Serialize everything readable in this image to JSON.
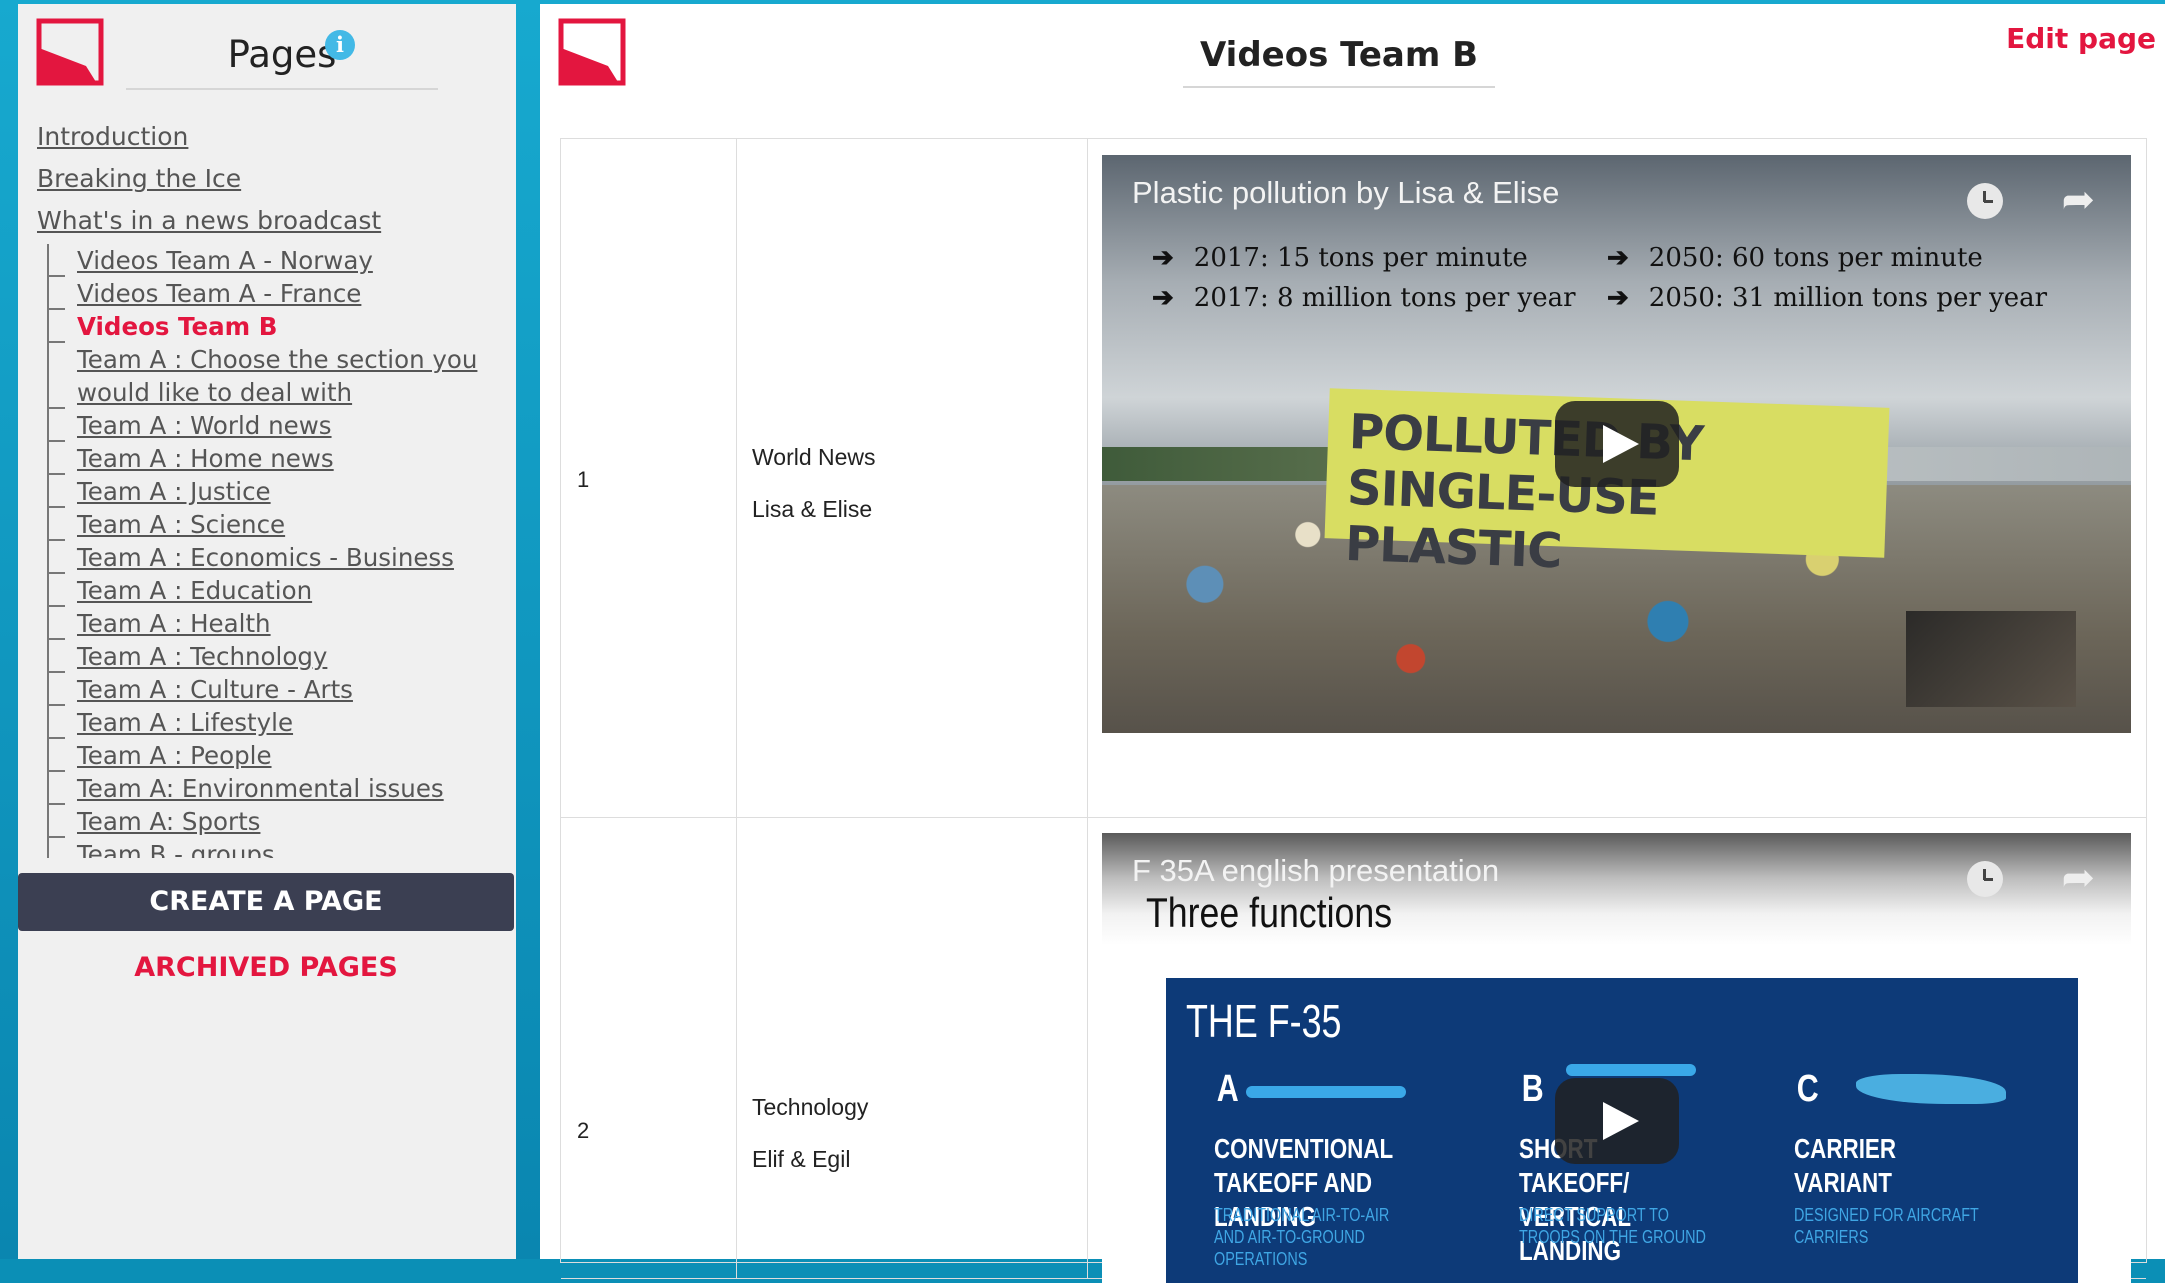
{
  "sidebar": {
    "title": "Pages",
    "top_links": [
      "Introduction",
      "Breaking the Ice",
      "What's in a news broadcast"
    ],
    "sub_links": [
      "Videos Team A - Norway",
      "Videos Team A - France",
      "Videos Team B",
      "Team A : Choose the section you would like to deal with",
      "Team A : World news",
      "Team A : Home news",
      "Team A : Justice",
      "Team A : Science",
      "Team A : Economics - Business",
      "Team A : Education",
      "Team A : Health",
      "Team A : Technology",
      "Team A : Culture - Arts",
      "Team A : Lifestyle",
      "Team A : People",
      "Team A: Environmental issues",
      "Team A: Sports",
      "Team B - groups"
    ],
    "active_item": "Videos Team B",
    "create_button": "CREATE A PAGE",
    "archived_link": "ARCHIVED PAGES"
  },
  "main": {
    "title": "Videos Team B",
    "edit_link": "Edit page",
    "rows": [
      {
        "number": "1",
        "category": "World News",
        "authors": "Lisa & Elise",
        "video": {
          "title": "Plastic pollution by Lisa & Elise",
          "stats": [
            "2017: 15 tons per minute",
            "2050: 60 tons per minute",
            "2017: 8 million tons per year",
            "2050: 31 million tons per year"
          ],
          "banner_text": "POLLUTED BY SINGLE-USE PLASTIC"
        }
      },
      {
        "number": "2",
        "category": "Technology",
        "authors": "Elif & Egil",
        "video": {
          "title": "F 35A english presentation",
          "slide_heading": "Three functions",
          "panel_title": "THE F-35",
          "variants": [
            {
              "letter": "A",
              "name": "CONVENTIONAL TAKEOFF AND LANDING",
              "desc": "TRADITIONAL AIR-TO-AIR AND AIR-TO-GROUND OPERATIONS"
            },
            {
              "letter": "B",
              "name": "SHORT TAKEOFF/ VERTICAL LANDING",
              "desc": "DIRECT SUPPORT TO TROOPS ON THE GROUND"
            },
            {
              "letter": "C",
              "name": "CARRIER VARIANT",
              "desc": "DESIGNED FOR AIRCRAFT CARRIERS"
            }
          ]
        }
      }
    ]
  },
  "colors": {
    "accent": "#e3163f",
    "button_bg": "#3b3f52",
    "info_icon": "#43b9e6"
  }
}
